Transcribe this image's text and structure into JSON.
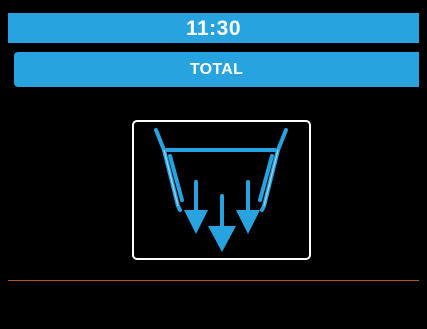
{
  "status_bar": {
    "time": "11:30"
  },
  "header": {
    "title": "TOTAL"
  },
  "main": {
    "icon": "container-dispense-icon"
  },
  "colors": {
    "accent": "#27a4e0",
    "background": "#000000",
    "text": "#ffffff",
    "divider": "#b05a1a"
  }
}
